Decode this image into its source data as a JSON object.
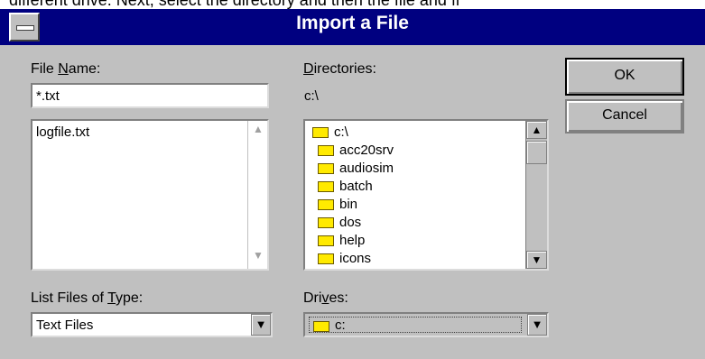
{
  "background_text": "different drive. Next, select the directory and then the file and fi",
  "dialog": {
    "title": "Import a File",
    "file_name": {
      "label_pre": "File ",
      "label_ul": "N",
      "label_post": "ame:",
      "value": "*.txt",
      "files": [
        "logfile.txt"
      ]
    },
    "directories": {
      "label_ul": "D",
      "label_post": "irectories:",
      "current_path": "c:\\",
      "items": [
        {
          "name": "c:\\",
          "icon": "open-folder-icon"
        },
        {
          "name": "acc20srv",
          "icon": "folder-icon"
        },
        {
          "name": "audiosim",
          "icon": "folder-icon"
        },
        {
          "name": "batch",
          "icon": "folder-icon"
        },
        {
          "name": "bin",
          "icon": "folder-icon"
        },
        {
          "name": "dos",
          "icon": "folder-icon"
        },
        {
          "name": "help",
          "icon": "folder-icon"
        },
        {
          "name": "icons",
          "icon": "folder-icon"
        }
      ]
    },
    "file_type": {
      "label_pre": "List Files of ",
      "label_ul": "T",
      "label_post": "ype:",
      "selected": "Text Files"
    },
    "drives": {
      "label_pre": "Dri",
      "label_ul": "v",
      "label_post": "es:",
      "selected": "c:"
    },
    "buttons": {
      "ok": "OK",
      "cancel": "Cancel"
    }
  },
  "colors": {
    "title_bar": "#000080",
    "dialog_bg": "#c0c0c0",
    "folder": "#ffea00"
  }
}
